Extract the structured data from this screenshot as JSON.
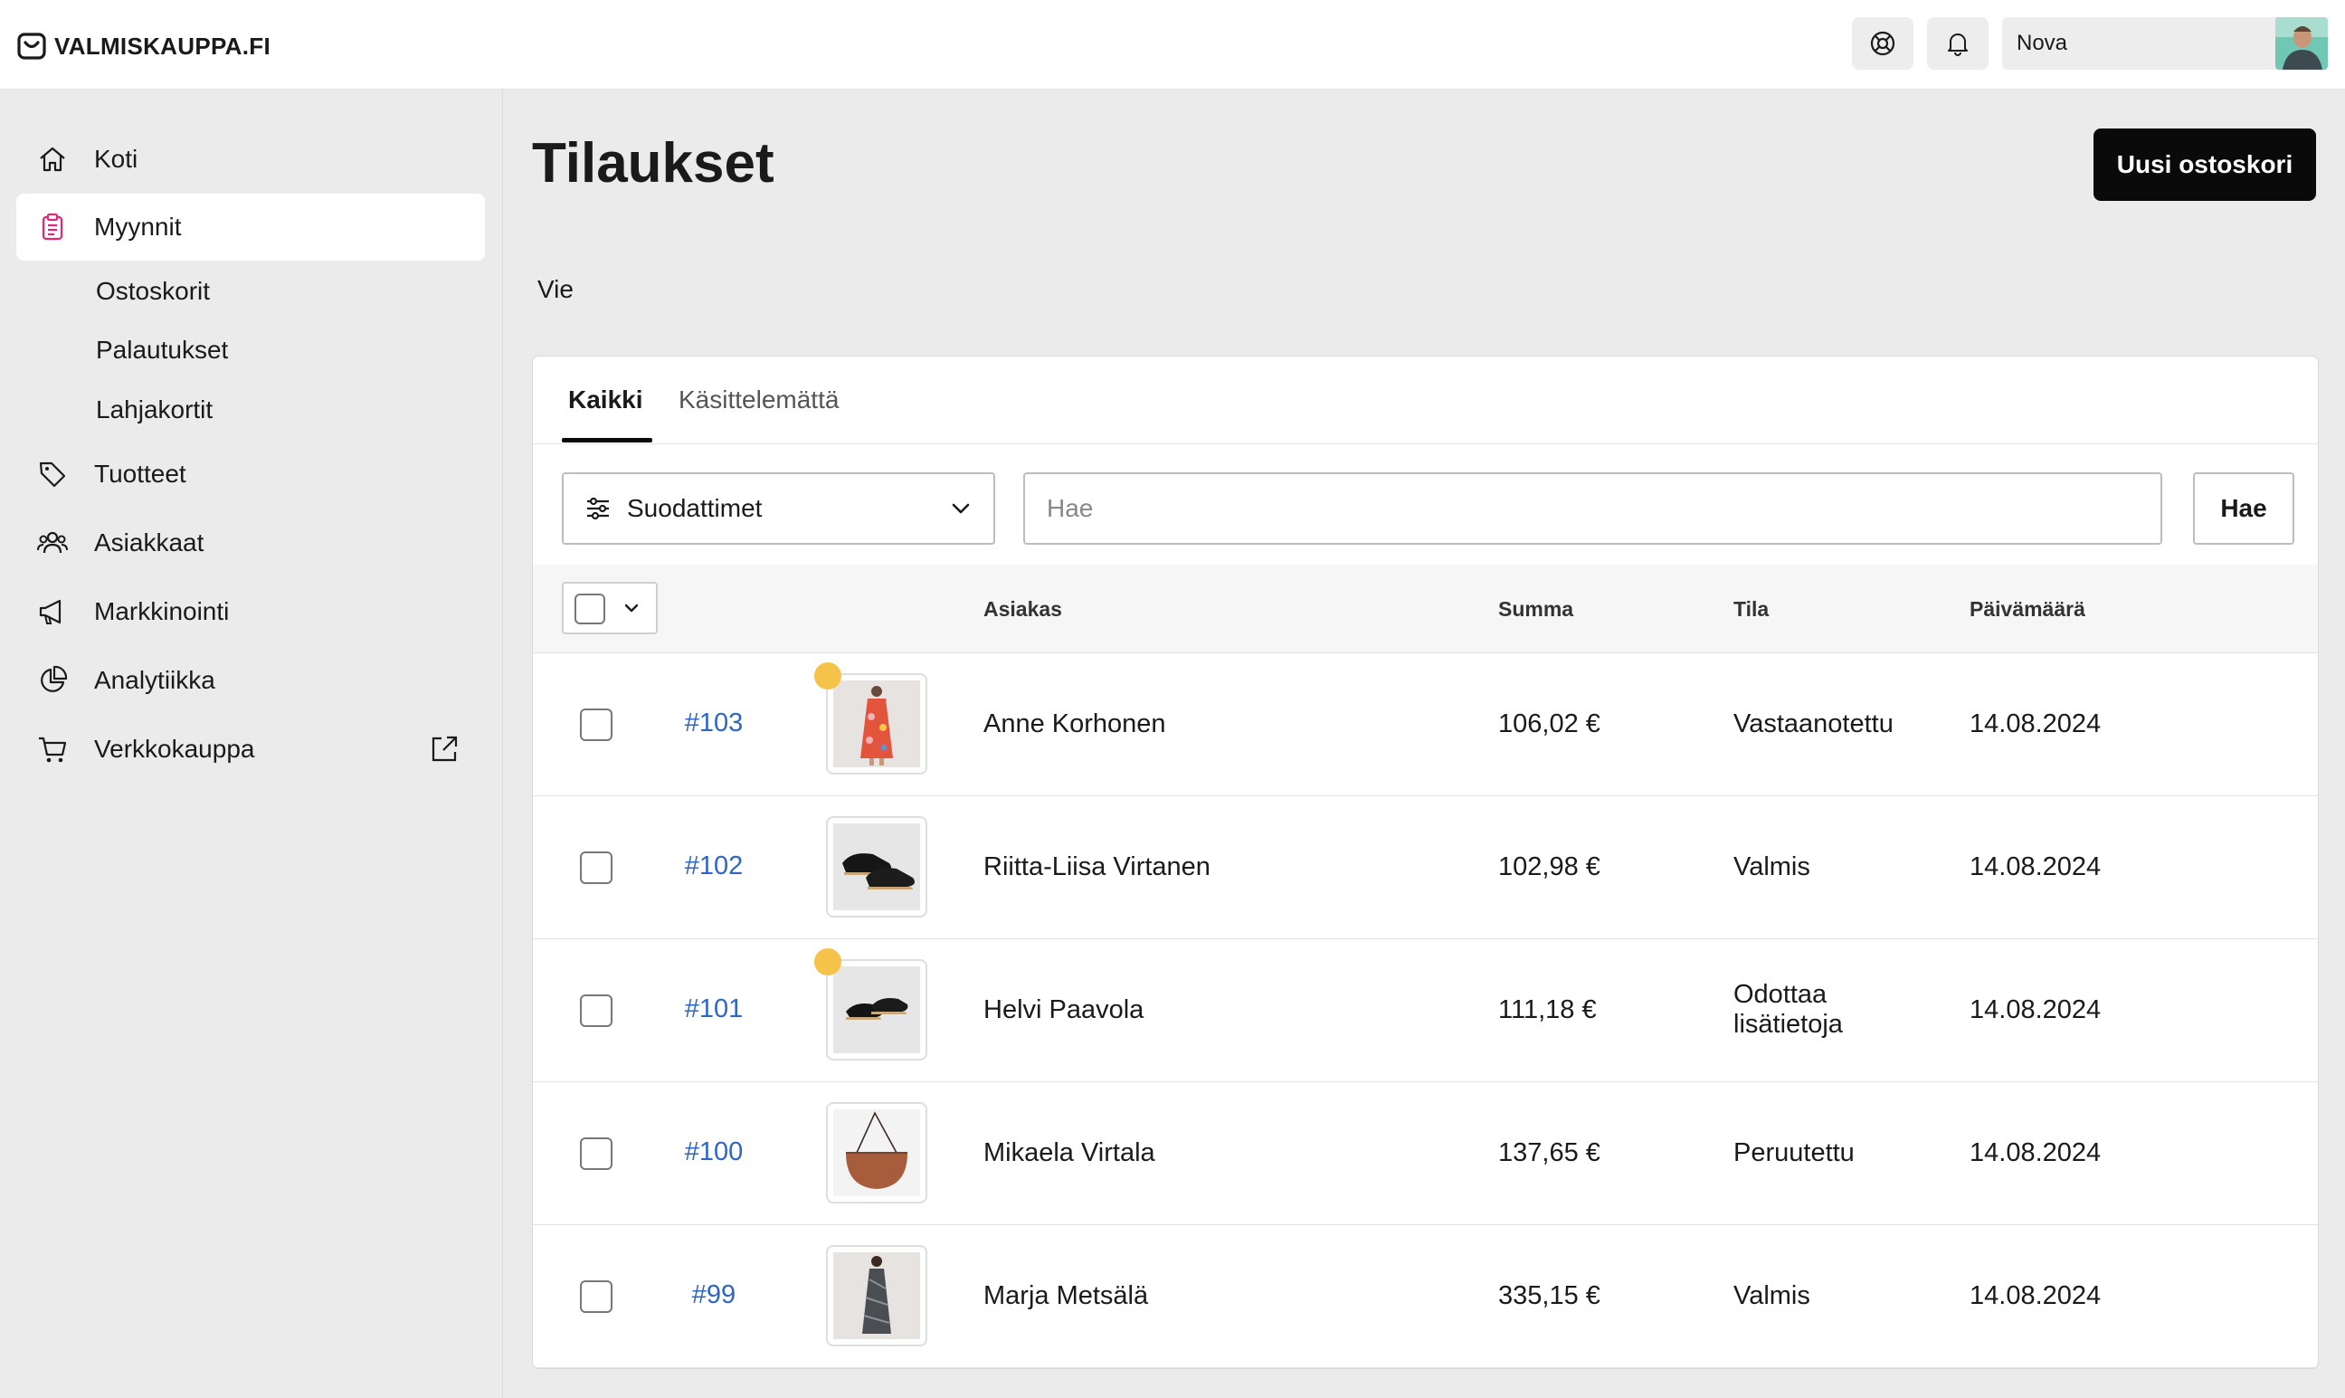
{
  "brand": {
    "name": "VALMISKAUPPA.FI",
    "icon": "bag-smile-icon"
  },
  "header": {
    "help_icon": "lifebuoy-icon",
    "notifications_icon": "bell-icon",
    "user_name": "Nova"
  },
  "sidebar": {
    "items": [
      {
        "label": "Koti",
        "icon": "home-icon"
      },
      {
        "label": "Myynnit",
        "icon": "clipboard-icon",
        "active": true
      },
      {
        "label": "Tuotteet",
        "icon": "tag-icon"
      },
      {
        "label": "Asiakkaat",
        "icon": "users-icon"
      },
      {
        "label": "Markkinointi",
        "icon": "megaphone-icon"
      },
      {
        "label": "Analytiikka",
        "icon": "pie-chart-icon"
      },
      {
        "label": "Verkkokauppa",
        "icon": "cart-icon",
        "external": true
      }
    ],
    "subitems": [
      {
        "label": "Ostoskorit"
      },
      {
        "label": "Palautukset"
      },
      {
        "label": "Lahjakortit"
      }
    ]
  },
  "page": {
    "title": "Tilaukset",
    "primary_button": "Uusi ostoskori",
    "export_label": "Vie"
  },
  "tabs": [
    {
      "label": "Kaikki",
      "active": true
    },
    {
      "label": "Käsittelemättä",
      "active": false
    }
  ],
  "filters": {
    "label": "Suodattimet",
    "search_placeholder": "Hae",
    "search_button": "Hae"
  },
  "table": {
    "columns": [
      "Asiakas",
      "Summa",
      "Tila",
      "Päivämäärä"
    ],
    "rows": [
      {
        "id": "#103",
        "customer": "Anne Korhonen",
        "sum": "106,02 €",
        "status": "Vastaanotettu",
        "date": "14.08.2024",
        "flag": true,
        "product": "dress-floral"
      },
      {
        "id": "#102",
        "customer": "Riitta-Liisa Virtanen",
        "sum": "102,98 €",
        "status": "Valmis",
        "date": "14.08.2024",
        "flag": false,
        "product": "espadrilles"
      },
      {
        "id": "#101",
        "customer": "Helvi Paavola",
        "sum": "111,18 €",
        "status": "Odottaa lisätietoja",
        "date": "14.08.2024",
        "flag": true,
        "product": "sandals"
      },
      {
        "id": "#100",
        "customer": "Mikaela Virtala",
        "sum": "137,65 €",
        "status": "Peruutettu",
        "date": "14.08.2024",
        "flag": false,
        "product": "handbag"
      },
      {
        "id": "#99",
        "customer": "Marja Metsälä",
        "sum": "335,15 €",
        "status": "Valmis",
        "date": "14.08.2024",
        "flag": false,
        "product": "dress-dark"
      }
    ]
  },
  "colors": {
    "accent_link": "#2f66c4",
    "active_nav_icon": "#e0287a",
    "flag_dot": "#f5c24a",
    "primary_button_bg": "#0a0a0a"
  }
}
